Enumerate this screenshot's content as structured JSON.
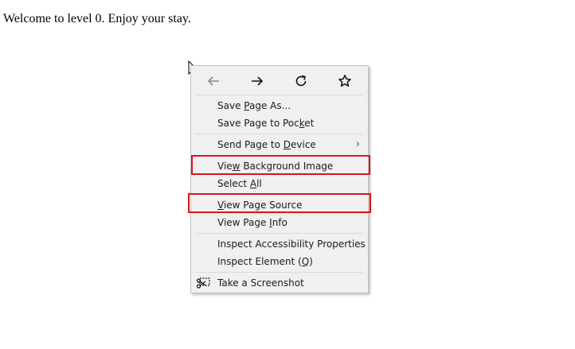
{
  "page": {
    "welcome_text": "Welcome to level 0. Enjoy your stay."
  },
  "context_menu": {
    "nav": {
      "back_icon": "back-arrow-icon",
      "forward_icon": "forward-arrow-icon",
      "reload_icon": "reload-icon",
      "bookmark_icon": "star-bookmark-icon"
    },
    "items": [
      {
        "label": "Save Page As...",
        "access_key": "P"
      },
      {
        "label": "Save Page to Pocket",
        "access_key": "k"
      },
      {
        "label": "Send Page to Device",
        "access_key": "D",
        "submenu": "›"
      },
      {
        "label": "View Background Image",
        "access_key": "w"
      },
      {
        "label": "Select All",
        "access_key": "A"
      },
      {
        "label": "View Page Source",
        "access_key": "V"
      },
      {
        "label": "View Page Info",
        "access_key": "I"
      },
      {
        "label": "Inspect Accessibility Properties"
      },
      {
        "label": "Inspect Element (Q)",
        "access_key": "Q"
      },
      {
        "label": "Take a Screenshot",
        "icon": "screenshot-scissors-icon"
      }
    ],
    "highlight_color": "#d9141a"
  }
}
